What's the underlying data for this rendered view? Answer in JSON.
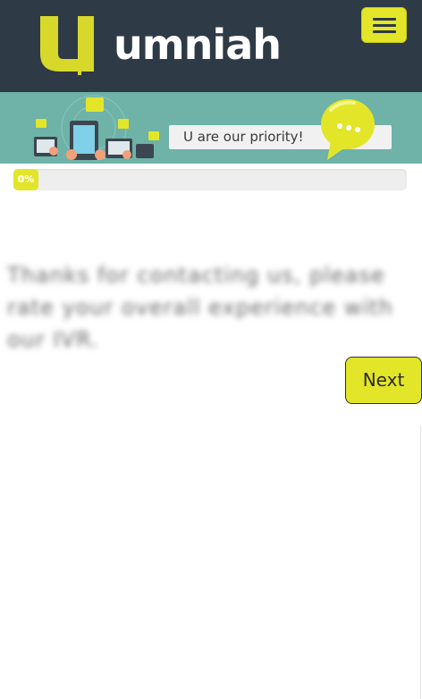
{
  "header": {
    "logo_text": "umniah",
    "menu_icon": "hamburger-icon",
    "brand_color": "#e3e529",
    "background_color": "#2e3a45"
  },
  "banner": {
    "tagline": "U are our priority!",
    "bubble_icon": "chat-bubble-icon",
    "background_color": "#6eb2a8"
  },
  "survey": {
    "progress_percent": 0,
    "progress_label": "0%",
    "question": "Thanks for contacting us, please rate your overall experience with our IVR.",
    "next_label": "Next"
  }
}
